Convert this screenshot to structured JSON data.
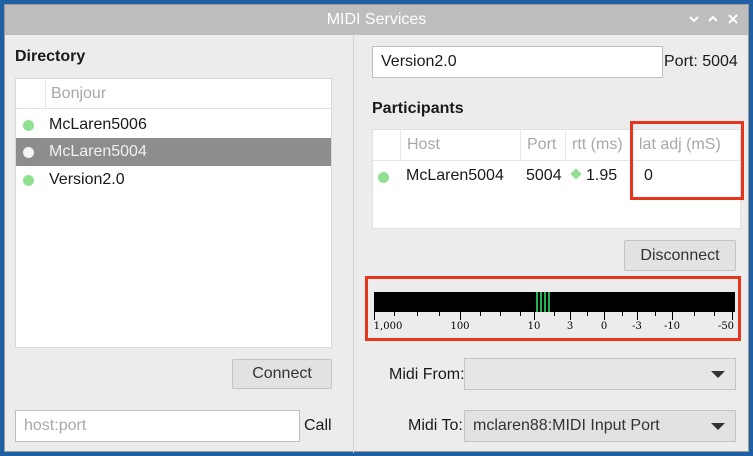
{
  "window": {
    "title": "MIDI Services",
    "controls": [
      "chevron-down-icon",
      "chevron-up-icon",
      "close-icon"
    ]
  },
  "directory": {
    "heading": "Directory",
    "column": "Bonjour",
    "items": [
      {
        "label": "McLaren5006",
        "status": "online",
        "selected": false
      },
      {
        "label": "McLaren5004",
        "status": "online",
        "selected": true
      },
      {
        "label": "Version2.0",
        "status": "online",
        "selected": false
      }
    ],
    "connect_label": "Connect",
    "host_placeholder": "host:port",
    "call_label": "Call"
  },
  "session": {
    "name_value": "Version2.0",
    "port_text": "Port: 5004"
  },
  "participants": {
    "heading": "Participants",
    "columns": {
      "host": "Host",
      "port": "Port",
      "rtt": "rtt (ms)",
      "latadj": "lat adj (mS)"
    },
    "rows": [
      {
        "host": "McLaren5004",
        "port": "5004",
        "rtt": "1.95",
        "latadj": "0"
      }
    ],
    "disconnect_label": "Disconnect"
  },
  "latency_meter": {
    "ticks": [
      "1,000",
      "100",
      "10",
      "3",
      "0",
      "-3",
      "-10",
      "-50"
    ]
  },
  "midi": {
    "from_label": "Midi From:",
    "from_value": "",
    "to_label": "Midi To:",
    "to_value": "mclaren88:MIDI Input Port"
  },
  "colors": {
    "online_dot": "#90e090",
    "highlight": "#e8341c",
    "meter_bar": "#22b14c"
  }
}
